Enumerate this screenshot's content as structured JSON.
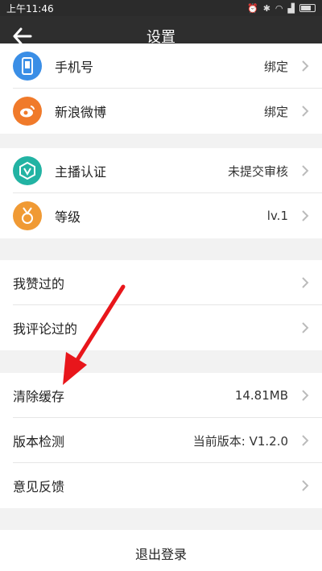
{
  "status_bar": {
    "time": "上午11:46",
    "icons": [
      "alarm-icon",
      "bluetooth-icon",
      "wifi-icon",
      "signal-icon",
      "battery-icon"
    ]
  },
  "header": {
    "title": "设置",
    "back_icon": "arrow-left-icon"
  },
  "accounts": [
    {
      "label": "手机号",
      "value": "绑定",
      "icon": "phone-icon",
      "color": "#3a8ee6"
    },
    {
      "label": "新浪微博",
      "value": "绑定",
      "icon": "weibo-icon",
      "color": "#f07a2a"
    }
  ],
  "profile": [
    {
      "label": "主播认证",
      "value": "未提交审核",
      "icon": "verified-v-icon",
      "color": "#22b3a3"
    },
    {
      "label": "等级",
      "value": "lv.1",
      "icon": "medal-icon",
      "color": "#f09a34"
    }
  ],
  "activity": [
    {
      "label": "我赞过的"
    },
    {
      "label": "我评论过的"
    }
  ],
  "system": [
    {
      "label": "清除缓存",
      "value": "14.81MB"
    },
    {
      "label": "版本检测",
      "value": "当前版本: V1.2.0"
    },
    {
      "label": "意见反馈",
      "value": ""
    }
  ],
  "logout_label": "退出登录",
  "annotation_color": "#e8161b"
}
